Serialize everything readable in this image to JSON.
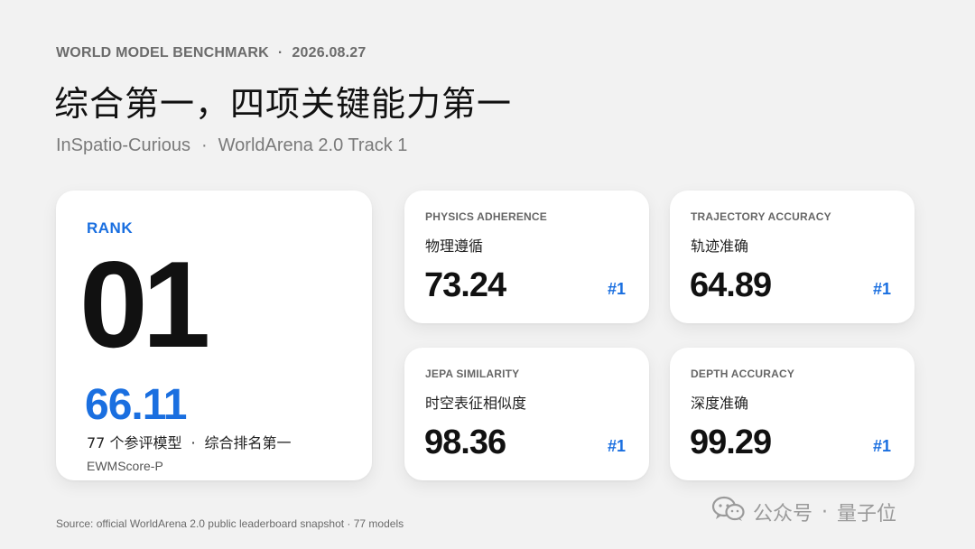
{
  "header": {
    "eyebrow": "WORLD MODEL BENCHMARK",
    "eyebrow_sep": "·",
    "date": "2026.08.27",
    "title": "综合第一，四项关键能力第一",
    "model": "InSpatio-Curious",
    "subtitle_sep": "·",
    "track": "WorldArena 2.0 Track 1"
  },
  "rank_card": {
    "label": "RANK",
    "rank": "01",
    "score": "66.11",
    "desc_left": "77 个参评模型",
    "desc_sep": "·",
    "desc_right": "综合排名第一",
    "metric_name": "EWMScore-P"
  },
  "metrics": [
    {
      "en": "PHYSICS ADHERENCE",
      "cn": "物理遵循",
      "value": "73.24",
      "rank": "#1"
    },
    {
      "en": "TRAJECTORY ACCURACY",
      "cn": "轨迹准确",
      "value": "64.89",
      "rank": "#1"
    },
    {
      "en": "JEPA SIMILARITY",
      "cn": "时空表征相似度",
      "value": "98.36",
      "rank": "#1"
    },
    {
      "en": "DEPTH ACCURACY",
      "cn": "深度准确",
      "value": "99.29",
      "rank": "#1"
    }
  ],
  "footer": {
    "source": "Source: official WorldArena 2.0 public leaderboard snapshot · 77 models"
  },
  "watermark": {
    "left": "公众号",
    "sep": "·",
    "right": "量子位",
    "icon": "wechat-icon"
  },
  "colors": {
    "accent": "#1a6fe0",
    "background": "#f2f2f2",
    "card": "#ffffff",
    "text": "#111111",
    "muted": "#7a7a7a"
  }
}
